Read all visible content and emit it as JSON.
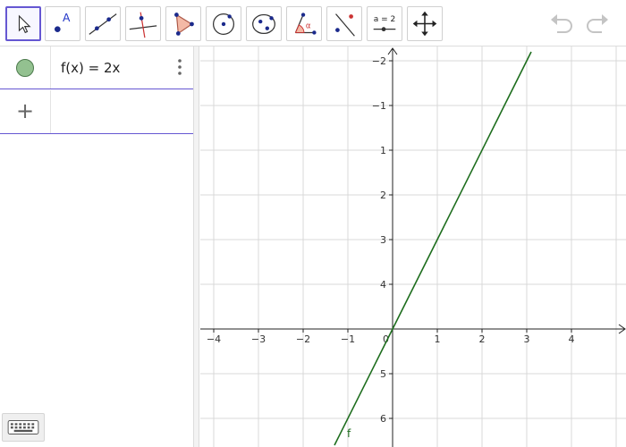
{
  "toolbar": {
    "tools": [
      {
        "id": "move",
        "icon": "cursor-icon",
        "active": true
      },
      {
        "id": "point",
        "icon": "point-icon",
        "label": "A"
      },
      {
        "id": "line",
        "icon": "line-icon"
      },
      {
        "id": "perpendicular",
        "icon": "perpendicular-line-icon"
      },
      {
        "id": "polygon",
        "icon": "polygon-icon"
      },
      {
        "id": "circle",
        "icon": "circle-center-point-icon"
      },
      {
        "id": "conic",
        "icon": "ellipse-icon"
      },
      {
        "id": "angle",
        "icon": "angle-icon",
        "label": "α"
      },
      {
        "id": "reflect",
        "icon": "reflect-about-line-icon"
      },
      {
        "id": "slider",
        "icon": "slider-icon",
        "label": "a = 2"
      },
      {
        "id": "move-graphics",
        "icon": "move-graphics-view-icon"
      }
    ],
    "undo_icon": "undo-icon",
    "redo_icon": "redo-icon",
    "accent": "#6557d2"
  },
  "algebra": {
    "items": [
      {
        "expression": "f(x) = 2x",
        "color": "#93c190",
        "visible": true
      }
    ],
    "new_input_symbol": "+"
  },
  "keyboard_icon": "keyboard-icon",
  "graphics": {
    "x_ticks": [
      "−4",
      "−3",
      "−2",
      "−1",
      "0",
      "1",
      "2",
      "3",
      "4"
    ],
    "y_ticks": [
      "6",
      "5",
      "4",
      "3",
      "2",
      "1",
      "−1",
      "−2"
    ],
    "function_label": "f",
    "function_color": "#1e6e1e",
    "grid_color": "#d8d8d8",
    "axis_color": "#222222"
  },
  "chart_data": {
    "type": "line",
    "function": "f(x) = 2x",
    "slope": 2,
    "intercept": 0,
    "xlim": [
      -4.3,
      5.2
    ],
    "ylim": [
      -2.6,
      6.2
    ],
    "x_tick_values": [
      -4,
      -3,
      -2,
      -1,
      0,
      1,
      2,
      3,
      4
    ],
    "y_tick_values": [
      -2,
      -1,
      1,
      2,
      3,
      4,
      5,
      6
    ],
    "grid": true,
    "series": [
      {
        "name": "f",
        "x": [
          -1.3,
          3.1
        ],
        "y": [
          -2.6,
          6.2
        ]
      }
    ]
  }
}
